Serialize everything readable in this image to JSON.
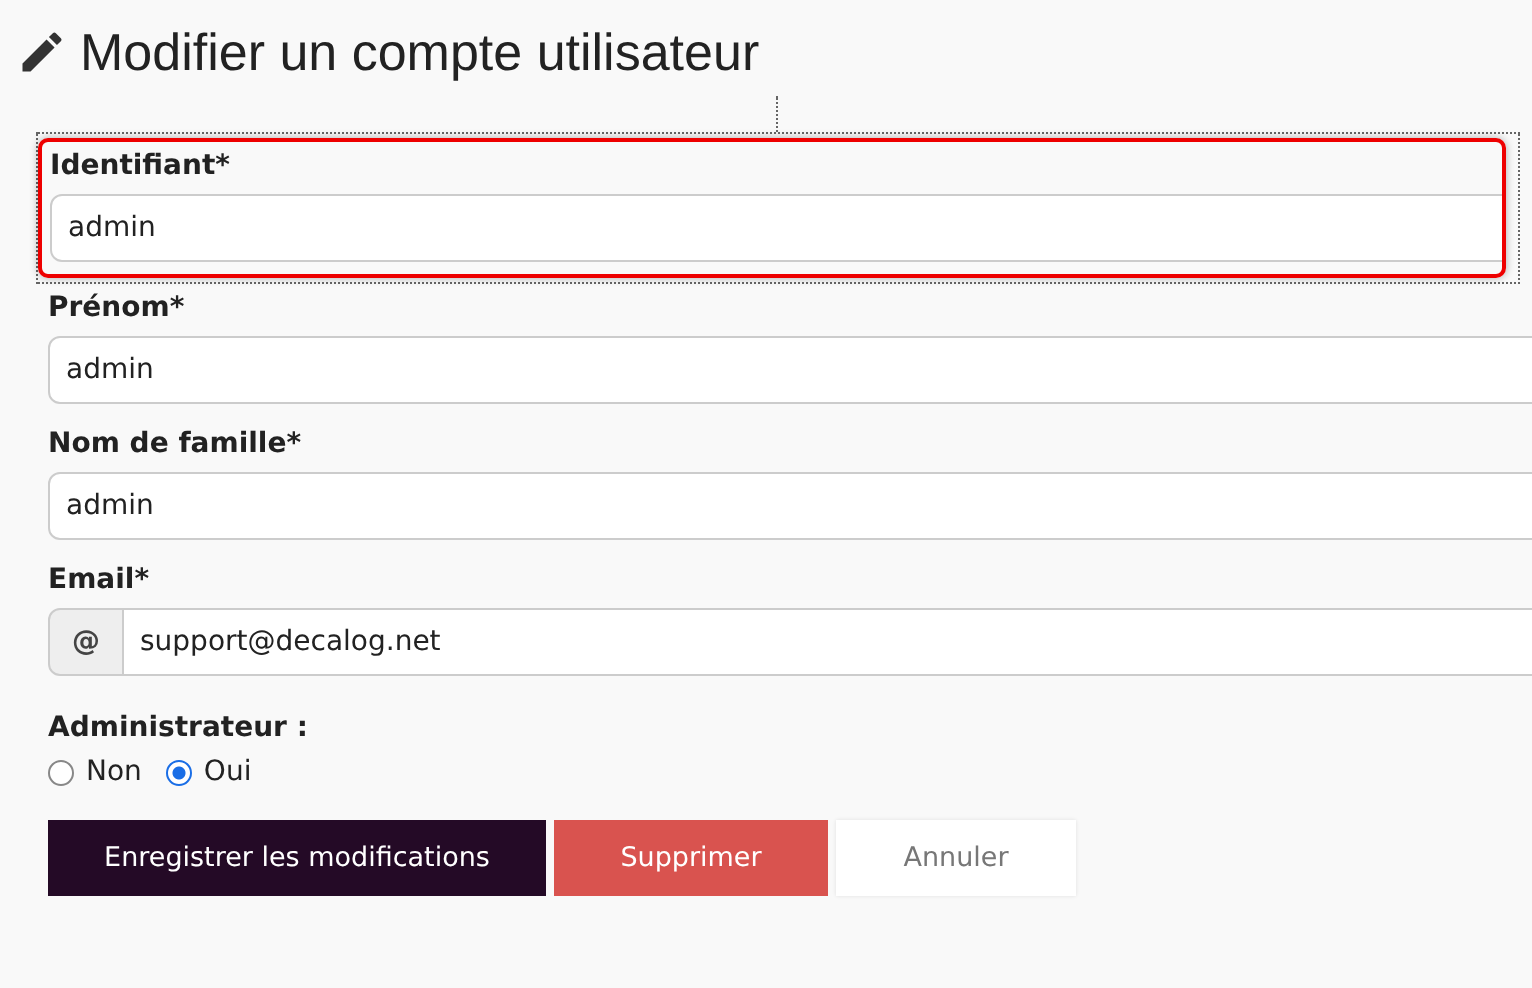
{
  "title": "Modifier un compte utilisateur",
  "fields": [
    {
      "kind": "text",
      "label": "Identifiant*",
      "value": "admin",
      "highlighted": true
    },
    {
      "kind": "text",
      "label": "Prénom*",
      "value": "admin",
      "highlighted": false
    },
    {
      "kind": "text",
      "label": "Nom de famille*",
      "value": "admin",
      "highlighted": false
    },
    {
      "kind": "prefixed",
      "label": "Email*",
      "prefix": "@",
      "value": "support@decalog.net",
      "highlighted": false
    }
  ],
  "admin": {
    "label": "Administrateur :",
    "options": [
      {
        "label": "Non",
        "selected": false
      },
      {
        "label": "Oui",
        "selected": true
      }
    ]
  },
  "buttons": [
    {
      "kind": "primary",
      "label": "Enregistrer les modifications"
    },
    {
      "kind": "danger",
      "label": "Supprimer"
    },
    {
      "kind": "plain",
      "label": "Annuler"
    }
  ]
}
